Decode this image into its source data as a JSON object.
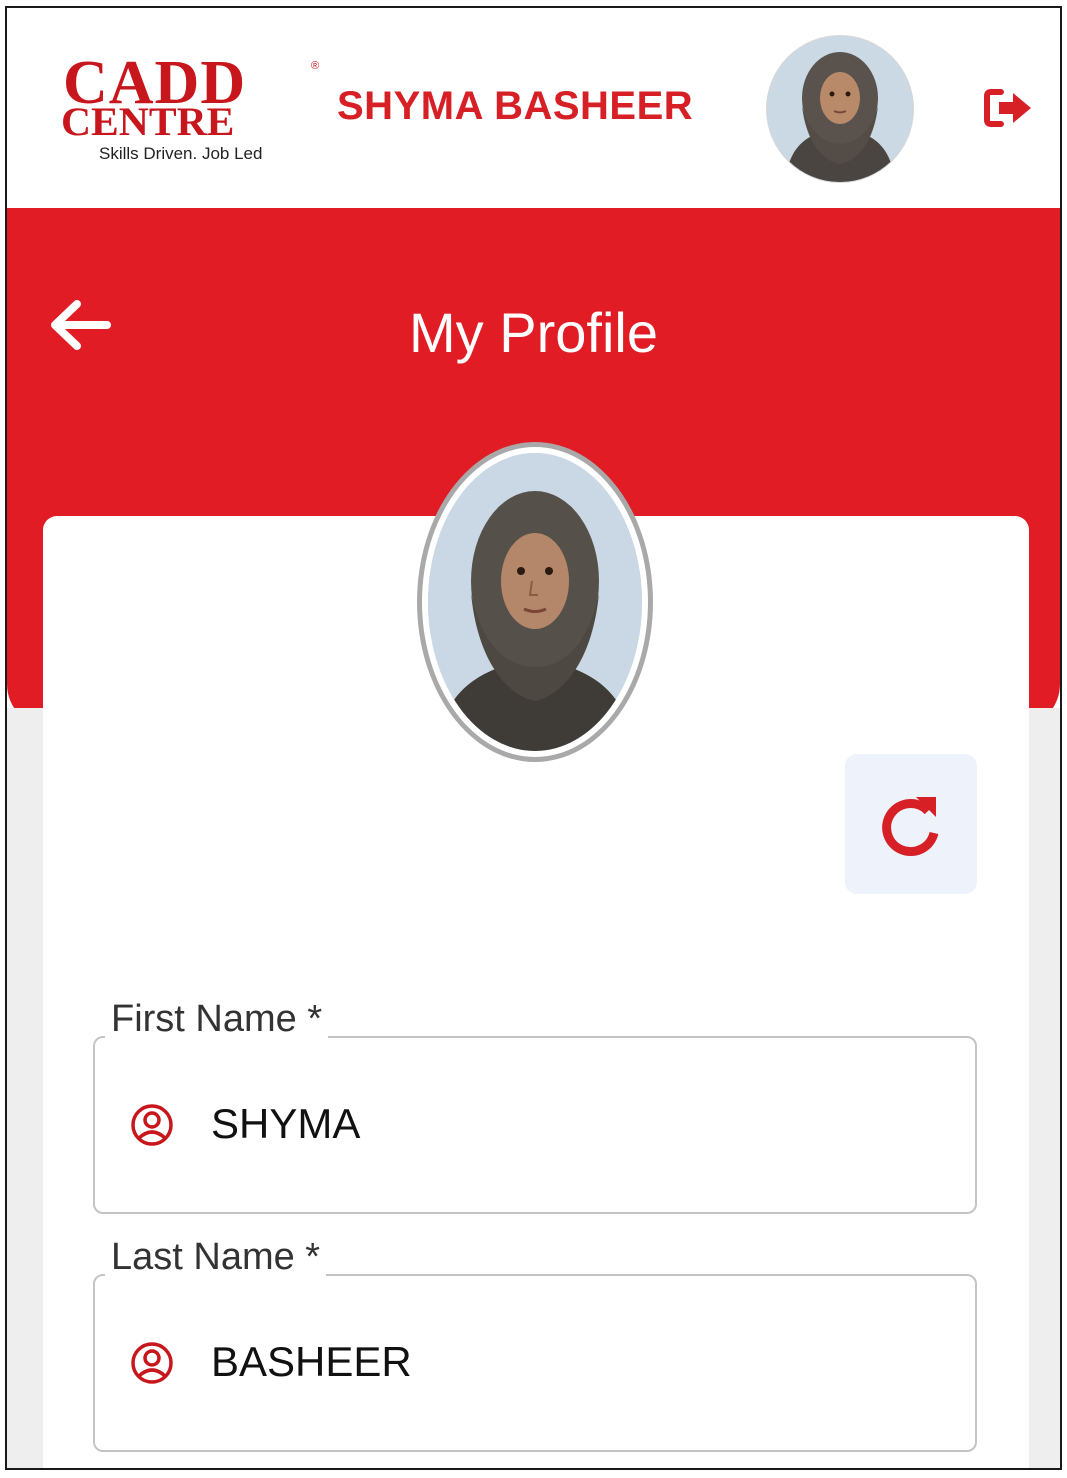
{
  "header": {
    "logo": {
      "brand_line1": "CADD",
      "brand_line2": "CENTRE",
      "registered_mark": "®",
      "tagline": "Skills Driven. Job Led"
    },
    "user_name": "SHYMA BASHEER",
    "avatar_icon": "user-photo-avatar",
    "logout_icon": "logout-icon"
  },
  "page": {
    "title": "My Profile",
    "back_icon": "arrow-left-icon"
  },
  "profile": {
    "photo_icon": "profile-photo",
    "refresh_icon": "refresh-icon"
  },
  "form": {
    "first_name": {
      "label": "First Name *",
      "value": "SHYMA",
      "icon": "user-circle-icon"
    },
    "last_name": {
      "label": "Last Name *",
      "value": "BASHEER",
      "icon": "user-circle-icon"
    }
  },
  "colors": {
    "brand_red": "#e11c24",
    "logo_red": "#c8161d",
    "refresh_bg": "#eef3fb"
  }
}
